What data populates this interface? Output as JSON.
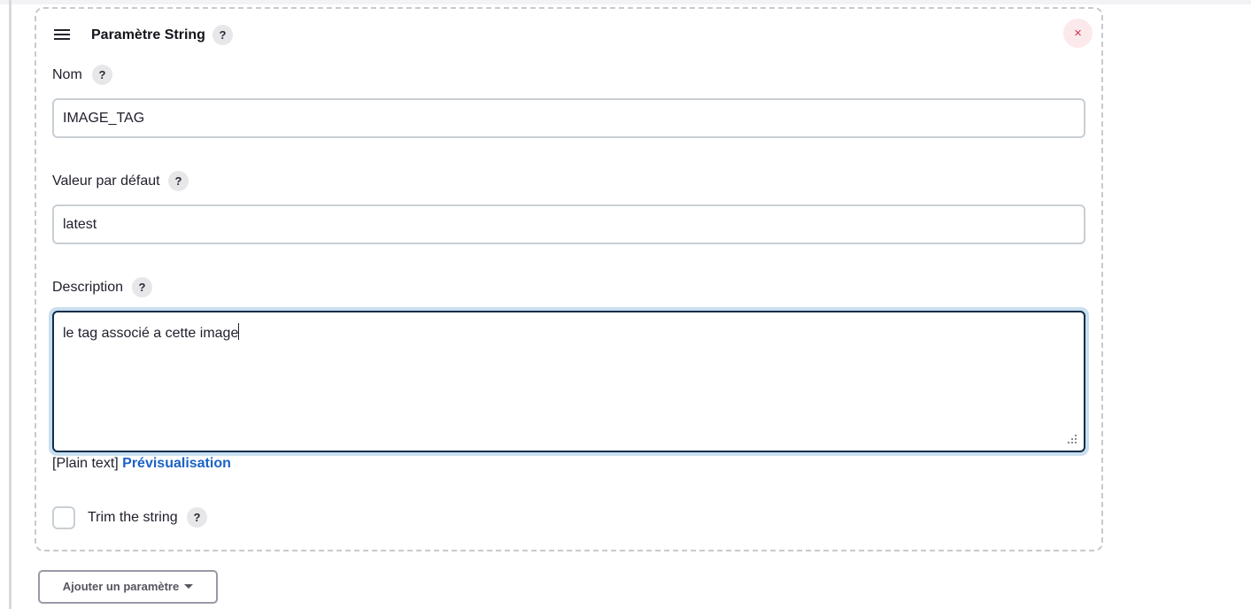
{
  "card": {
    "title": "Paramètre String",
    "help_glyph": "?",
    "close_glyph": "×",
    "drag_icon": "hamburger-drag-icon"
  },
  "fields": {
    "name": {
      "label": "Nom",
      "value": "IMAGE_TAG"
    },
    "default_value": {
      "label": "Valeur par défaut",
      "value": "latest"
    },
    "description": {
      "label": "Description",
      "value": "le tag associé a cette image"
    }
  },
  "format": {
    "plain_text": "[Plain text]",
    "preview_link": "Prévisualisation"
  },
  "trim": {
    "label": "Trim the string",
    "checked": false
  },
  "add_button": {
    "label": "Ajouter un paramètre"
  },
  "colors": {
    "link": "#1c62c4",
    "close": "#d6344d",
    "focus_ring": "#c9dff0"
  }
}
